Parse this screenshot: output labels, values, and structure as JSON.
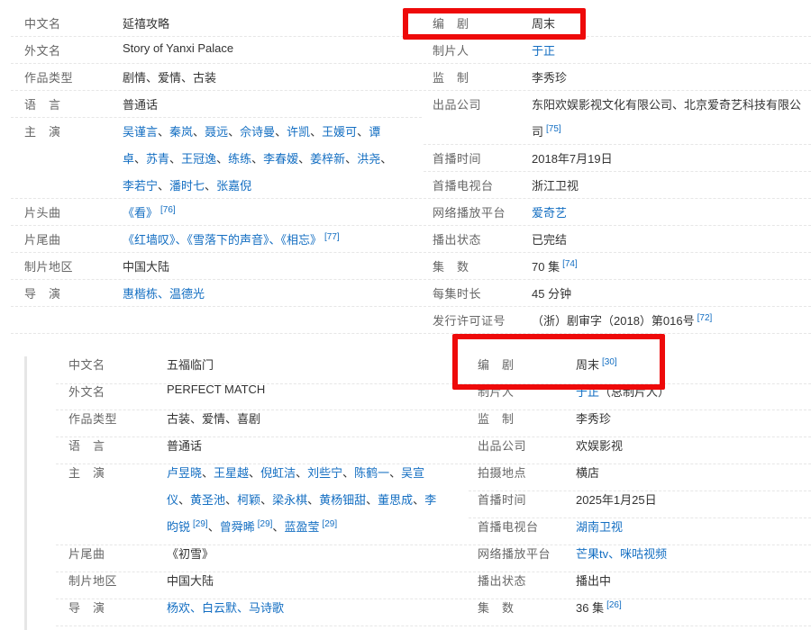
{
  "box1": {
    "left": [
      {
        "label": "中文名",
        "value": "延禧攻略"
      },
      {
        "label": "外文名",
        "value": "Story of Yanxi Palace"
      },
      {
        "label": "作品类型",
        "value": "剧情、爱情、古装"
      },
      {
        "label": "语　言",
        "value": "普通话"
      },
      {
        "label": "主　演",
        "line1": [
          "吴谨言",
          "秦岚",
          "聂远",
          "佘诗曼",
          "许凯",
          "王媛可",
          "谭"
        ],
        "line2": [
          "卓",
          "苏青",
          "王冠逸",
          "练练",
          "李春嫒",
          "姜梓新",
          "洪尧"
        ],
        "line3": [
          "李若宁",
          "潘时七",
          "张嘉倪"
        ]
      },
      {
        "label": "片头曲",
        "value": "《看》",
        "ref": "[76]"
      },
      {
        "label": "片尾曲",
        "value": "《红墙叹》、《雪落下的声音》、《相忘》",
        "ref": "[77]"
      },
      {
        "label": "制片地区",
        "value": "中国大陆"
      },
      {
        "label": "导　演",
        "value": "惠楷栋、温德光"
      }
    ],
    "right": [
      {
        "label": "编　剧",
        "value": "周末"
      },
      {
        "label": "制片人",
        "value": "于正"
      },
      {
        "label": "监　制",
        "value": "李秀珍"
      },
      {
        "label": "出品公司",
        "value": "东阳欢娱影视文化有限公司、北京爱奇艺科技有限公",
        "cont": "司",
        "ref": "[75]"
      },
      {
        "label": "首播时间",
        "value": "2018年7月19日"
      },
      {
        "label": "首播电视台",
        "value": "浙江卫视"
      },
      {
        "label": "网络播放平台",
        "value": "爱奇艺"
      },
      {
        "label": "播出状态",
        "value": "已完结"
      },
      {
        "label": "集　数",
        "value": "70 集",
        "ref": "[74]"
      },
      {
        "label": "每集时长",
        "value": "45 分钟"
      },
      {
        "label": "发行许可证号",
        "value": "（浙）剧审字（2018）第016号",
        "ref": "[72]"
      }
    ]
  },
  "box2": {
    "left": [
      {
        "label": "中文名",
        "value": "五福临门"
      },
      {
        "label": "外文名",
        "value": "PERFECT MATCH"
      },
      {
        "label": "作品类型",
        "value": "古装、爱情、喜剧"
      },
      {
        "label": "语　言",
        "value": "普通话"
      },
      {
        "label": "主　演",
        "line1": [
          "卢昱晓",
          "王星越",
          "倪虹洁",
          "刘些宁",
          "陈鹤一",
          "吴宣"
        ],
        "line2": [
          "仪",
          "黄圣池",
          "柯颖",
          "梁永棋",
          "黄杨钿甜",
          "董思成",
          "李"
        ],
        "line3": [
          "昀锐",
          "曾舜晞",
          "蓝盈莹"
        ],
        "line3refs": [
          "[29]",
          "[29]",
          "[29]"
        ]
      },
      {
        "label": "片尾曲",
        "value": "《初雪》"
      },
      {
        "label": "制片地区",
        "value": "中国大陆"
      },
      {
        "label": "导　演",
        "value": "杨欢、白云默、马诗歌"
      }
    ],
    "right": [
      {
        "label": "编　剧",
        "value": "周末",
        "ref": "[30]"
      },
      {
        "label": "制片人",
        "value": "于正",
        "suffix": "（总制片人）"
      },
      {
        "label": "监　制",
        "value": "李秀珍"
      },
      {
        "label": "出品公司",
        "value": "欢娱影视"
      },
      {
        "label": "拍摄地点",
        "value": "横店"
      },
      {
        "label": "首播时间",
        "value": "2025年1月25日"
      },
      {
        "label": "首播电视台",
        "value": "湖南卫视"
      },
      {
        "label": "网络播放平台",
        "value": "芒果tv、咪咕视频"
      },
      {
        "label": "播出状态",
        "value": "播出中"
      },
      {
        "label": "集　数",
        "value": "36 集",
        "ref": "[26]"
      }
    ]
  },
  "sep": "、",
  "colors": {
    "link": "#136ec2",
    "label": "#666666",
    "highlight": "#ee0a0a"
  }
}
